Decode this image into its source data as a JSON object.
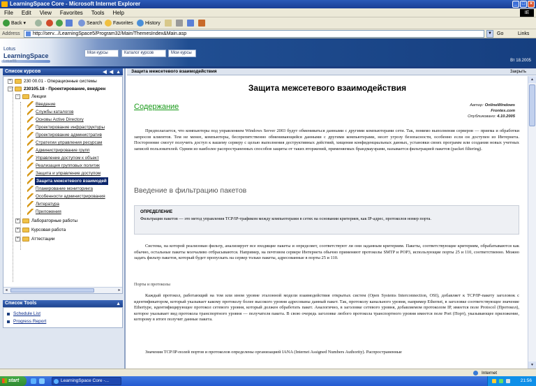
{
  "window": {
    "title": "LearningSpace Core - Microsoft Internet Explorer",
    "brand_logo": "IE"
  },
  "menu": [
    "File",
    "Edit",
    "View",
    "Favorites",
    "Tools",
    "Help"
  ],
  "toolbar": {
    "back": "Back",
    "search": "Search",
    "favorites": "Favorites",
    "history": "History"
  },
  "address": {
    "label": "Address",
    "url": "http://serv.../LearningSpace5/Program32/Main/ThemesIndex&Main.asp",
    "go": "Go",
    "links": "Links"
  },
  "banner": {
    "brand_line1": "Lotus",
    "brand_line2": "LearningSpace",
    "brand_line3": "Lotus®5",
    "date": "Вт 18.2005"
  },
  "tabs": [
    "Мои курсы",
    "Каталог курсов",
    "Мои курсы"
  ],
  "sidebar": {
    "title": "Список курсов",
    "controls": "◀ ◀ ▲",
    "tree": [
      {
        "label": "230 00.01 - Операционные системы",
        "type": "course"
      },
      {
        "label": "230105.18 - Проектирование, внедрен",
        "type": "course"
      },
      {
        "label": "Лекции",
        "type": "folder"
      },
      {
        "label": "Введение",
        "type": "item"
      },
      {
        "label": "Службы каталогов",
        "type": "item"
      },
      {
        "label": "Основы Active Directory",
        "type": "item"
      },
      {
        "label": "Проектирование инфраструктуры",
        "type": "item"
      },
      {
        "label": "Проектирование административ",
        "type": "item"
      },
      {
        "label": "Стратегии управления ресурсам",
        "type": "item"
      },
      {
        "label": "Администрирование групп",
        "type": "item"
      },
      {
        "label": "Управление доступом к объект",
        "type": "item"
      },
      {
        "label": "Реализация групповых политик",
        "type": "item"
      },
      {
        "label": "Защита и управление доступом",
        "type": "item"
      },
      {
        "label": "Защита межсетевого взаимодей",
        "type": "item"
      },
      {
        "label": "Планирование мониторинга",
        "type": "item"
      },
      {
        "label": "Особенности администрирования",
        "type": "item"
      },
      {
        "label": "Литература",
        "type": "item"
      },
      {
        "label": "Приложения",
        "type": "item"
      },
      {
        "label": "Лабораторные работы",
        "type": "folder"
      },
      {
        "label": "Курсовая работа",
        "type": "folder"
      },
      {
        "label": "Аттестации",
        "type": "folder"
      }
    ],
    "tools_title": "Список Tools",
    "tools": [
      "Schedule List",
      "Progress Report"
    ]
  },
  "content": {
    "header": "Защита межсетевого взаимодействия",
    "header_right": "Закрыть",
    "title": "Защита межсетевого взаимодействия",
    "toc": "Содержание",
    "meta": {
      "author_label": "Автор:",
      "author": "OnlineWindows",
      "author2": "Frontes.com",
      "date_label": "Опубликовано:",
      "date": "4.10.2005"
    },
    "intro": "Предполагается, что компьютеры под управлением Windows Server 2003 будут обмениваться данными с другими компьютерами сети. Так, помимо выполнения серверов — приема и обработки запросов клиентов. Тем не менее, компьютеры, беспрепятственно обменивающийся данными с другими компьютерами, несет угрозу безопасности, особенно если он доступен из Интернета. Посторонние смогут получить доступ к вашему серверу с целью выполнения деструктивных действий, хищения конфиденциальных данных, установки своих программ или создания новых учетных записей пользователей. Одним из наиболее распространенных способов защиты от таких вторжений, применяемых брандмауэрами, называется фильтрацией пакетов (packet filtering).",
    "h2": "Введение в фильтрацию пакетов",
    "def_title": "ОПРЕДЕЛЕНИЕ",
    "def_body": "Фильтрация пакетов — это метод управления TCP/IP-трафиком между компьютерами в сетях на основании критериев, как IP-адрес, протоколов номер порта.",
    "p2": "Система, на которой реализован фильтр, анализирует все входящие пакеты и определяет, соответствуют ли они заданным критериям. Пакеты, соответствующие критериям, обрабатываются как обычно, остальные пакеты молчаливо отбрасываются. Например, на почтовом сервере Интернета обычно применяют протоколы SMTP и POP3, использующие порты 25 и 110, соответственно. Можно задать фильтр пакетов, который будет пропускать на сервер только пакеты, адресованные в порты 25 и 110.",
    "p3_label": "Порты и протоколы",
    "p4": "Каждый протокол, работающий на том или ином уровне эталонной модели взаимодействия открытых систем (Open Systems Interconnection, OSI), добавляет к TCP/IP-пакету заголовок с идентификатором, который указывает какому протоколу более высокого уровня адресованы данный пакет. Так, протоколу канального уровня, например Ethernet, в заголовке соответствующее значение Ethertype, идентифицирующее протокол сетевого уровня, который должен обработать пакет. Аналогично, в заголовке сетевого уровня, добавляемом протоколом IP, имеется поле Protocol (Протокол), которое указывает вид протокола транспортного уровня — получателя пакета. В свою очередь заголовке любого протокола транспортного уровня имеется поле Port (Порт), указывающее приложение, которому в итоге получит данные пакета.",
    "p5": "Значения TCP/IP-полей портов и протоколов определены организацией IANA (Internet Assigned Numbers Authority). Распространенные"
  },
  "status": {
    "zone": "Internet"
  },
  "taskbar": {
    "start": "start",
    "task": "LearningSpace Core -...",
    "clock": "21:56"
  }
}
